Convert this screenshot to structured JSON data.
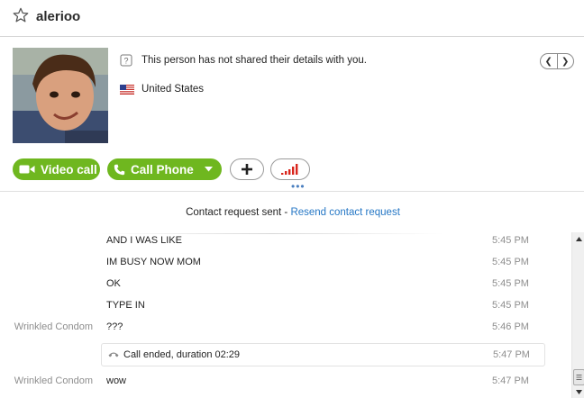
{
  "header": {
    "contact_name": "alerioo",
    "favorite_icon": "star-icon"
  },
  "profile": {
    "privacy_icon": "question-card-icon",
    "privacy_text": "This person has not shared their details with you.",
    "flag_icon": "us-flag-icon",
    "country": "United States"
  },
  "actions": {
    "video_call_label": "Video call",
    "call_phone_label": "Call Phone",
    "add_icon": "plus-icon",
    "signal_icon": "signal-bars-icon",
    "more_indicator": "•••"
  },
  "chat": {
    "request_sent": "Contact request sent - ",
    "resend_link": "Resend contact request",
    "messages": [
      {
        "sender": "",
        "text": "AND I WAS LIKE",
        "time": "5:45 PM"
      },
      {
        "sender": "",
        "text": "IM BUSY NOW MOM",
        "time": "5:45 PM"
      },
      {
        "sender": "",
        "text": "OK",
        "time": "5:45 PM"
      },
      {
        "sender": "",
        "text": "TYPE IN",
        "time": "5:45 PM"
      },
      {
        "sender": "Wrinkled Condom",
        "text": "???",
        "time": "5:46 PM"
      },
      {
        "sender": "Wrinkled Condom",
        "text": "wow",
        "time": "5:47 PM"
      }
    ],
    "call_event": {
      "text": "Call ended, duration 02:29",
      "time": "5:47 PM"
    }
  },
  "colors": {
    "accent_green": "#6fb71f",
    "link_blue": "#2577c5",
    "signal_red": "#d9251c"
  }
}
